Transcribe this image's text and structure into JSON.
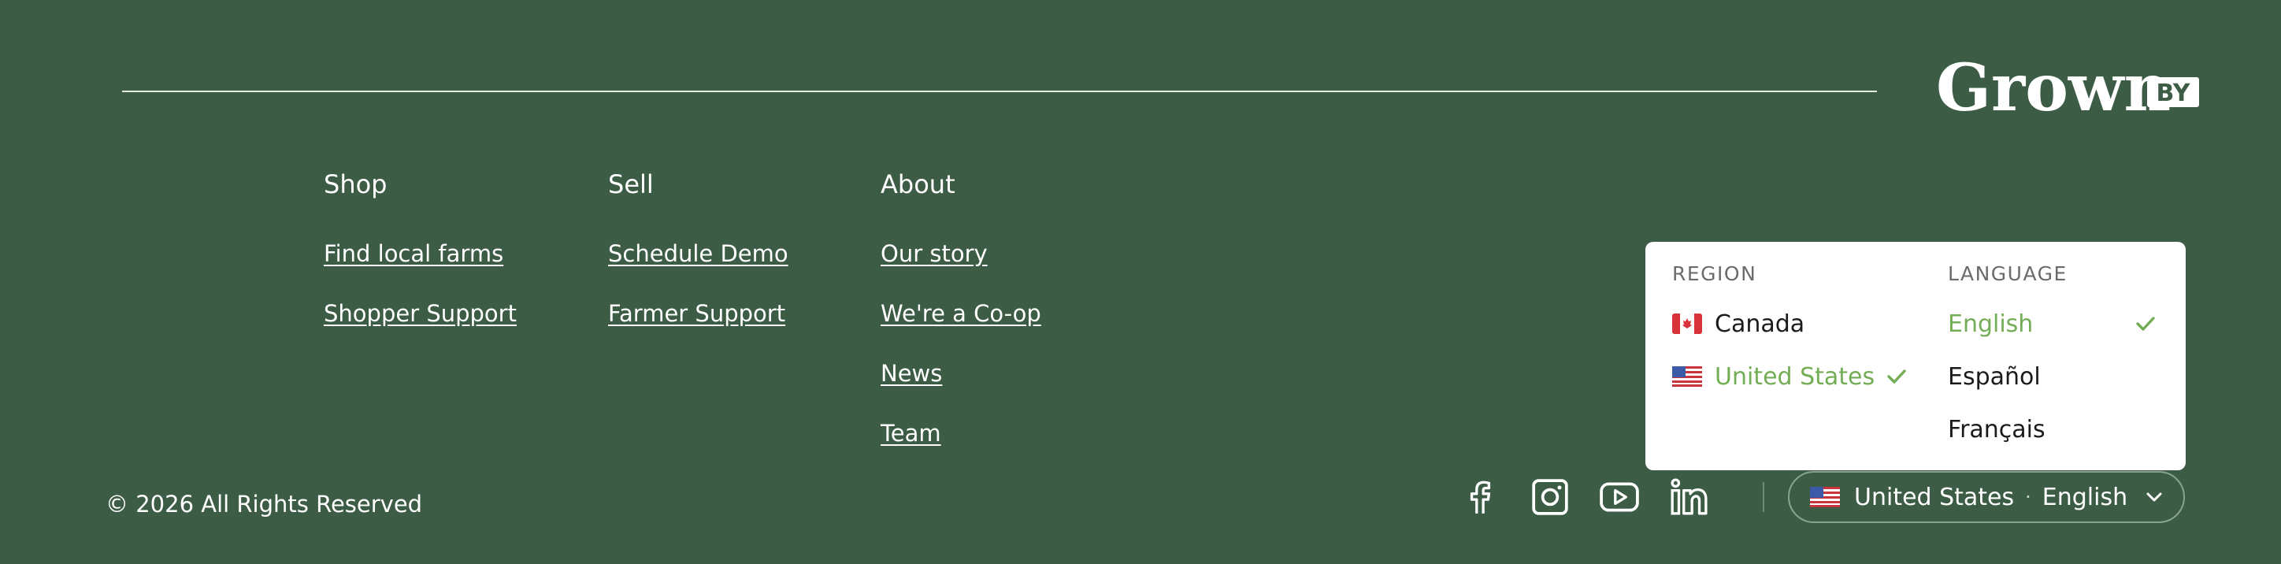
{
  "brand": {
    "logo_text": "Grown",
    "logo_suffix": "BY"
  },
  "footer": {
    "columns": [
      {
        "heading": "Shop",
        "links": [
          "Find local farms",
          "Shopper Support"
        ]
      },
      {
        "heading": "Sell",
        "links": [
          "Schedule Demo",
          "Farmer Support"
        ]
      },
      {
        "heading": "About",
        "links": [
          "Our story",
          "We're a Co-op",
          "News",
          "Team"
        ]
      }
    ],
    "copyright": "© 2026 All Rights Reserved"
  },
  "socials": [
    {
      "name": "facebook-icon"
    },
    {
      "name": "instagram-icon"
    },
    {
      "name": "youtube-icon"
    },
    {
      "name": "linkedin-icon"
    }
  ],
  "locale_selector": {
    "region": "United States",
    "separator": "·",
    "language": "English",
    "popup": {
      "region_title": "REGION",
      "language_title": "LANGUAGE",
      "regions": [
        {
          "label": "Canada",
          "flag": "ca-flag-icon",
          "selected": false
        },
        {
          "label": "United States",
          "flag": "us-flag-icon",
          "selected": true
        }
      ],
      "languages": [
        {
          "label": "English",
          "selected": true
        },
        {
          "label": "Español",
          "selected": false
        },
        {
          "label": "Français",
          "selected": false
        }
      ]
    }
  },
  "colors": {
    "background": "#3d5c45",
    "selected": "#73ad55",
    "popup_bg": "#ffffff"
  }
}
